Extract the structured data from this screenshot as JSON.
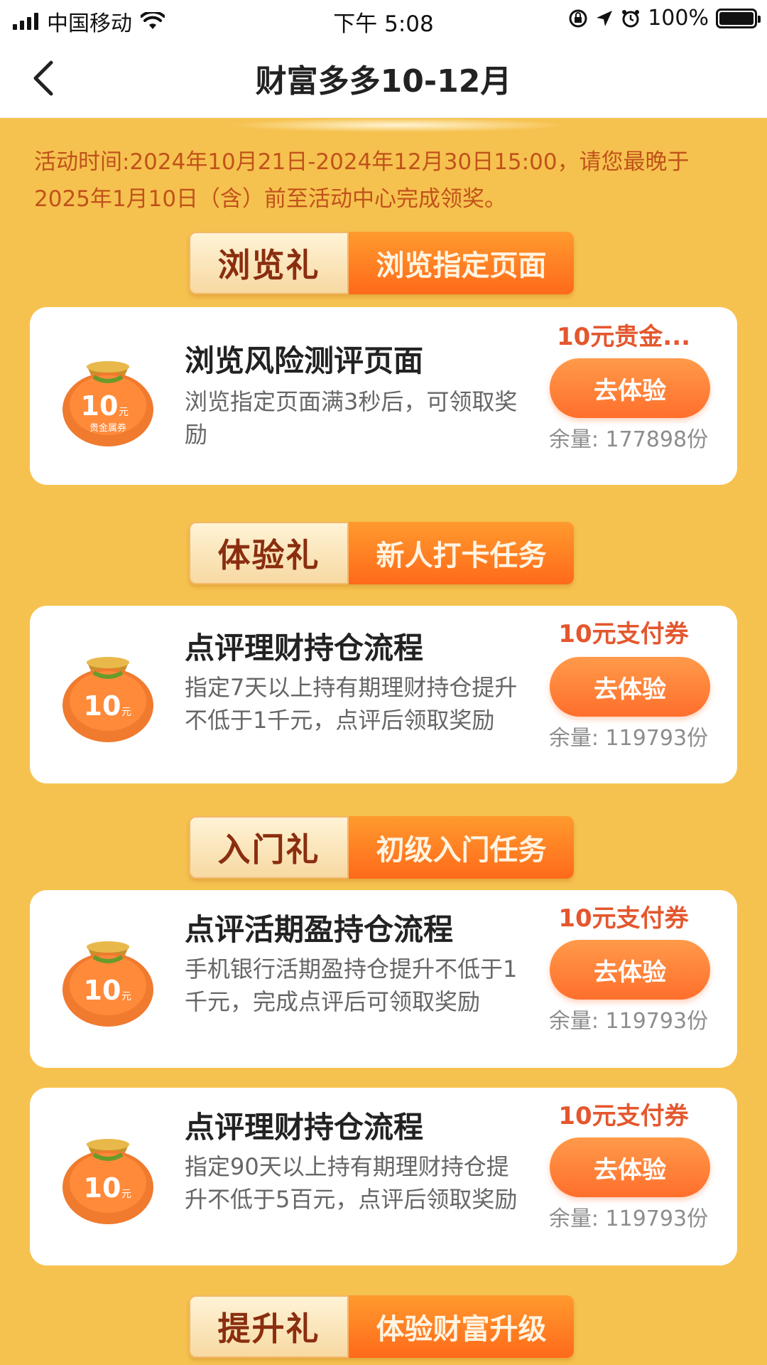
{
  "status_bar": {
    "carrier": "中国移动",
    "time": "下午 5:08",
    "battery": "100%"
  },
  "nav": {
    "title": "财富多多10-12月"
  },
  "intro": {
    "text": "活动时间:2024年10月21日-2024年12月30日15:00，请您最晚于2025年1月10日（含）前至活动中心完成领奖。"
  },
  "coupon_icon_text": {
    "value": "10",
    "unit": "元",
    "caption": "贵金属券"
  },
  "sections": [
    {
      "left": "浏览礼",
      "right": "浏览指定页面",
      "cards": [
        {
          "title": "浏览风险测评页面",
          "desc": "浏览指定页面满3秒后，可领取奖励",
          "reward": "10元贵金...",
          "button": "去体验",
          "remain": "余量: 177898份"
        }
      ]
    },
    {
      "left": "体验礼",
      "right": "新人打卡任务",
      "cards": [
        {
          "title": "点评理财持仓流程",
          "desc": "指定7天以上持有期理财持仓提升不低于1千元，点评后领取奖励",
          "reward": "10元支付券",
          "button": "去体验",
          "remain": "余量: 119793份"
        }
      ]
    },
    {
      "left": "入门礼",
      "right": "初级入门任务",
      "cards": [
        {
          "title": "点评活期盈持仓流程",
          "desc": "手机银行活期盈持仓提升不低于1千元，完成点评后可领取奖励",
          "reward": "10元支付券",
          "button": "去体验",
          "remain": "余量: 119793份"
        },
        {
          "title": "点评理财持仓流程",
          "desc": "指定90天以上持有期理财持仓提升不低于5百元，点评后领取奖励",
          "reward": "10元支付券",
          "button": "去体验",
          "remain": "余量: 119793份"
        }
      ]
    },
    {
      "left": "提升礼",
      "right": "体验财富升级",
      "cards": []
    }
  ],
  "colors": {
    "page_bg": "#f6c24f",
    "accent_orange": "#ff6f2c",
    "reward_red": "#e4572e",
    "intro_text": "#c0521b"
  }
}
